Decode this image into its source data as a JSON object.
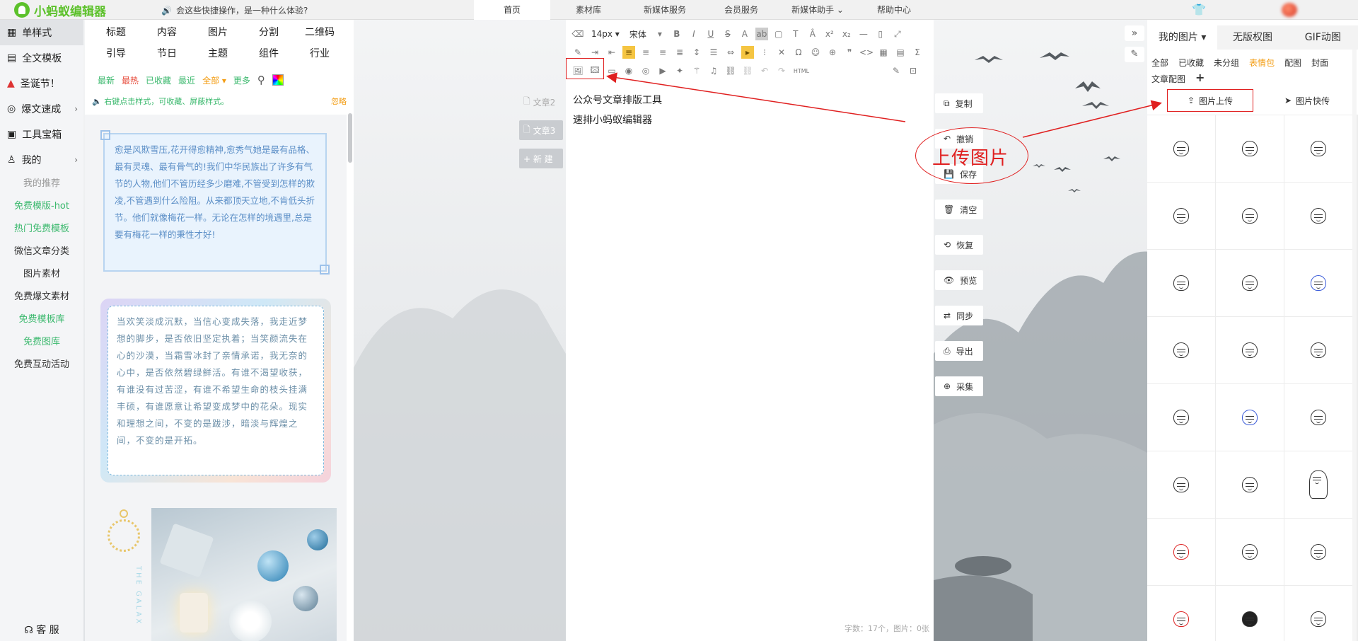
{
  "app": {
    "logo": "小蚂蚁编辑器"
  },
  "topbar": {
    "announcement": "会这些快捷操作，是一种什么体验?",
    "nav": [
      "首页",
      "素材库",
      "新媒体服务",
      "会员服务",
      "新媒体助手 ⌄",
      "帮助中心"
    ]
  },
  "sidebar": {
    "items": [
      {
        "label": "单样式",
        "icon": "grid-icon"
      },
      {
        "label": "全文模板",
        "icon": "template-icon"
      },
      {
        "label": "圣诞节！",
        "icon": "santa-hat-icon"
      },
      {
        "label": "爆文速成",
        "icon": "fire-icon"
      },
      {
        "label": "工具宝箱",
        "icon": "toolbox-icon"
      },
      {
        "label": "我的",
        "icon": "user-icon"
      }
    ],
    "subitems": [
      "我的推荐",
      "免费模版-hot",
      "热门免费模板",
      "微信文章分类",
      "图片素材",
      "免费爆文素材",
      "免费模板库",
      "免费图库",
      "免费互动活动"
    ],
    "service": "客 服"
  },
  "stylepanel": {
    "categories": [
      "标题",
      "内容",
      "图片",
      "分割",
      "二维码",
      "引导",
      "节日",
      "主题",
      "组件",
      "行业"
    ],
    "filters": [
      "最新",
      "最热",
      "已收藏",
      "最近",
      "全部 ▾",
      "更多"
    ],
    "tip": "右键点击样式，可收藏、屏蔽样式。",
    "ignore": "忽略",
    "card1_text": "愈是风欺雪压,花开得愈精神,愈秀气她是最有品格、最有灵魂、最有骨气的!我们中华民族出了许多有气节的人物,他们不管历经多少磨难,不管受到怎样的欺凌,不管遇到什么险阻。从来都顶天立地,不肯低头折节。他们就像梅花一样。无论在怎样的境遇里,总是要有梅花一样的秉性才好!",
    "card2_text": "当欢笑淡成沉默，当信心变成失落，我走近梦想的脚步，是否依旧坚定执着；当笑颜流失在心的沙漠，当霜雪冰封了亲情承诺，我无奈的心中，是否依然碧绿鲜活。有谁不渴望收获，有谁没有过苦涩，有谁不希望生命的枝头挂满丰硕，有谁愿意让希望变成梦中的花朵。现实和理想之间，不变的是跋涉，暗淡与辉煌之间，不变的是开拓。",
    "card3_vtext": "THE GALAX"
  },
  "articles": {
    "tab1": "文章2",
    "tab2": "文章3",
    "new": "+ 新 建"
  },
  "editor": {
    "font_size": "14px ▾",
    "font_family": "宋体",
    "lines": [
      "公众号文章排版工具",
      "速排小蚂蚁编辑器"
    ],
    "word_count": "字数：17个，图片：0张"
  },
  "actions": [
    "复制",
    "撤销",
    "保存",
    "清空",
    "恢复",
    "预览",
    "同步",
    "导出",
    "采集"
  ],
  "annotation": {
    "label": "上传图片"
  },
  "rightpanel": {
    "tabs": [
      "我的图片 ▾",
      "无版权图",
      "GIF动图"
    ],
    "categories": [
      "全部",
      "已收藏",
      "未分组",
      "表情包",
      "配图",
      "封面",
      "文章配图"
    ],
    "upload": "图片上传",
    "quick": "图片快传"
  },
  "colors": {
    "accent_green": "#3cb96e",
    "logo_green": "#5cc12a",
    "annotation_red": "#e02020",
    "orange": "#f39c12"
  }
}
